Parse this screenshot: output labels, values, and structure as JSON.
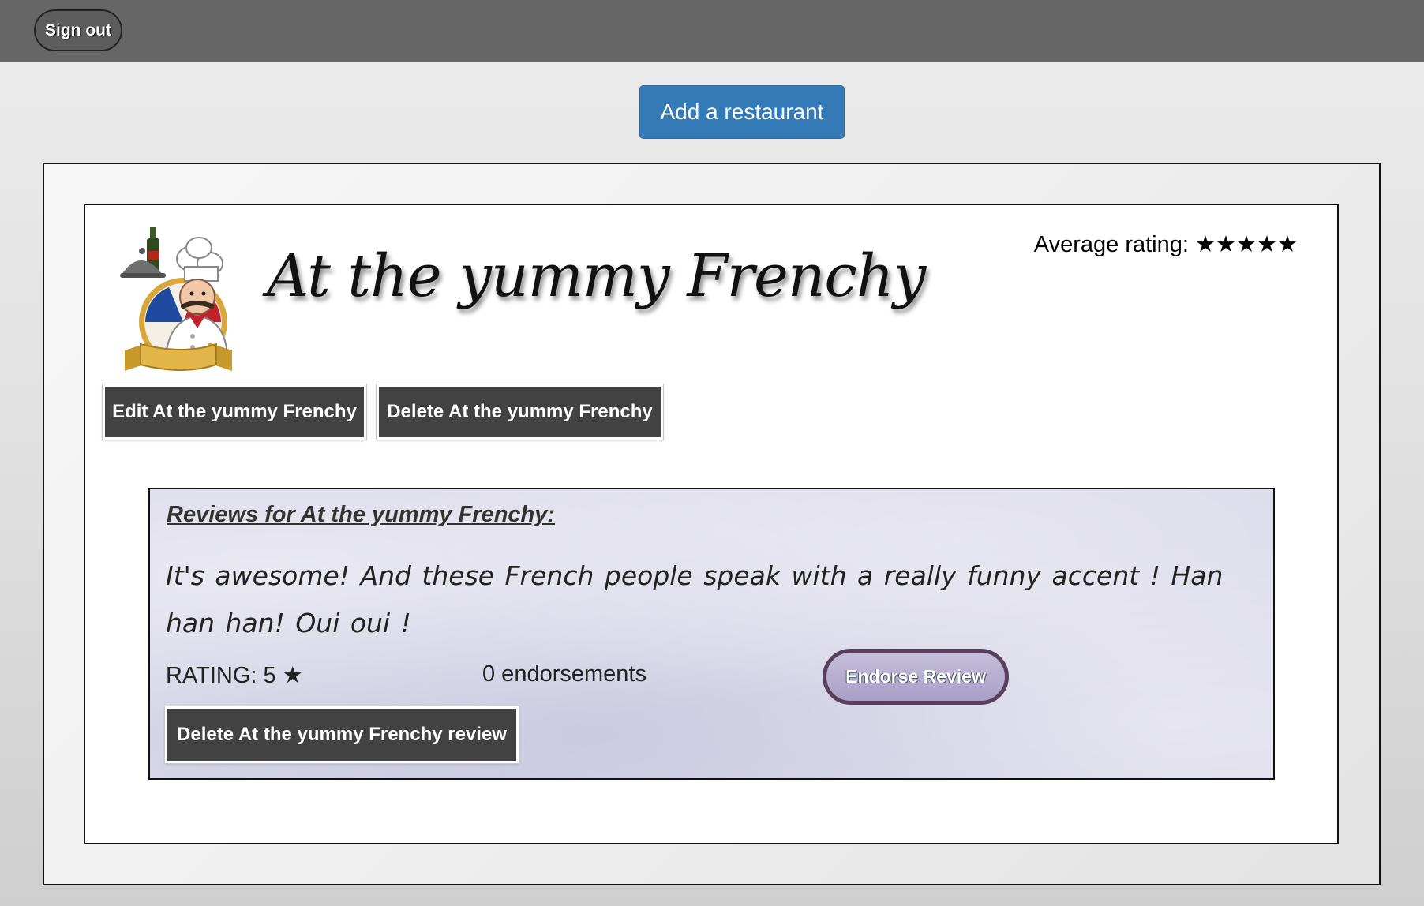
{
  "topbar": {
    "signout_label": "Sign out"
  },
  "main": {
    "add_restaurant_label": "Add a restaurant"
  },
  "restaurant": {
    "name": "At the yummy Frenchy",
    "average_rating_label": "Average rating: ★★★★★",
    "average_rating": 5,
    "edit_label": "Edit At the yummy Frenchy",
    "delete_label": "Delete At the yummy Frenchy",
    "logo_icon": "chef-logo-icon"
  },
  "reviews": {
    "heading": "Reviews for At the yummy Frenchy:",
    "items": [
      {
        "text": "It's awesome! And these French people speak with a really funny accent ! Han han han! Oui oui !",
        "rating_label": "RATING: 5 ★",
        "endorsements_label": "0 endorsements",
        "endorse_label": "Endorse Review",
        "delete_label": "Delete At the yummy Frenchy review"
      }
    ]
  },
  "colors": {
    "topbar": "#666666",
    "primary_button": "#337ab7",
    "dark_button": "#424242",
    "endorse_border": "#56405e",
    "review_background": "#d9d8e8"
  }
}
